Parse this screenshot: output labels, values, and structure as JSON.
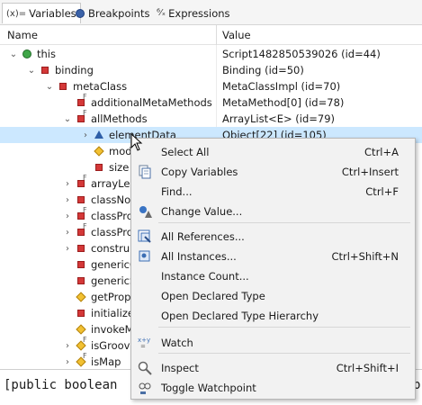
{
  "tabs": [
    {
      "label": "Variables",
      "icon_glyph": "(x)=",
      "icon": "variables-icon"
    },
    {
      "label": "Breakpoints",
      "icon": "breakpoint-icon"
    },
    {
      "label": "Expressions",
      "icon": "expressions-icon",
      "icon_glyph": "⁶⁄ₓ"
    }
  ],
  "columns": {
    "name": "Name",
    "value": "Value"
  },
  "rows": [
    {
      "name": "this",
      "value": "Script1482850539026  (id=44)",
      "icon": "object-dot-icon"
    },
    {
      "name": "binding",
      "value": "Binding  (id=50)",
      "icon": "private-field-icon"
    },
    {
      "name": "metaClass",
      "value": "MetaClassImpl  (id=70)",
      "icon": "private-field-icon"
    },
    {
      "name": "additionalMetaMethods",
      "value": "MetaMethod[0]  (id=78)",
      "icon": "private-final-field-icon"
    },
    {
      "name": "allMethods",
      "value": "ArrayList<E>  (id=79)",
      "icon": "private-final-field-icon"
    },
    {
      "name": "elementData",
      "value": "Object[22]  (id=105)",
      "icon": "default-field-icon"
    },
    {
      "name": "mod",
      "value": "",
      "icon": "protected-field-icon"
    },
    {
      "name": "size",
      "value": "",
      "icon": "private-field-icon"
    },
    {
      "name": "arrayLen",
      "value": "",
      "icon": "private-final-field-icon"
    },
    {
      "name": "classNod",
      "value": "",
      "icon": "private-field-icon"
    },
    {
      "name": "classPro",
      "value": "",
      "icon": "private-final-field-icon"
    },
    {
      "name": "classPro",
      "value": "",
      "icon": "private-final-field-icon"
    },
    {
      "name": "constru",
      "value": "",
      "icon": "private-field-icon"
    },
    {
      "name": "genericC",
      "value": "",
      "icon": "private-field-icon"
    },
    {
      "name": "genericS",
      "value": "",
      "icon": "private-field-icon"
    },
    {
      "name": "getProp",
      "value": "",
      "icon": "protected-field-icon"
    },
    {
      "name": "initialize",
      "value": "",
      "icon": "private-field-icon"
    },
    {
      "name": "invokeM",
      "value": "",
      "icon": "protected-field-icon"
    },
    {
      "name": "isGroovy",
      "value": "",
      "icon": "protected-final-field-icon"
    },
    {
      "name": "isMap",
      "value": "",
      "icon": "protected-final-field-icon"
    }
  ],
  "console": {
    "left_text": "[public boolean",
    "right_text": "b"
  },
  "context_menu": {
    "items": [
      {
        "label": "Select All",
        "shortcut": "Ctrl+A",
        "icon": ""
      },
      {
        "label": "Copy Variables",
        "shortcut": "Ctrl+Insert",
        "icon": "copy-icon"
      },
      {
        "label": "Find...",
        "shortcut": "Ctrl+F",
        "icon": ""
      },
      {
        "label": "Change Value...",
        "shortcut": "",
        "icon": "change-value-icon"
      },
      {
        "label": "All References...",
        "shortcut": "",
        "icon": "references-icon"
      },
      {
        "label": "All Instances...",
        "shortcut": "Ctrl+Shift+N",
        "icon": "instances-icon"
      },
      {
        "label": "Instance Count...",
        "shortcut": "",
        "icon": ""
      },
      {
        "label": "Open Declared Type",
        "shortcut": "",
        "icon": ""
      },
      {
        "label": "Open Declared Type Hierarchy",
        "shortcut": "",
        "icon": ""
      },
      {
        "label": "Watch",
        "shortcut": "",
        "icon": "watch-icon",
        "icon_glyph": "x+y"
      },
      {
        "label": "Inspect",
        "shortcut": "Ctrl+Shift+I",
        "icon": "inspect-icon"
      },
      {
        "label": "Toggle Watchpoint",
        "shortcut": "",
        "icon": "watchpoint-icon"
      }
    ]
  }
}
